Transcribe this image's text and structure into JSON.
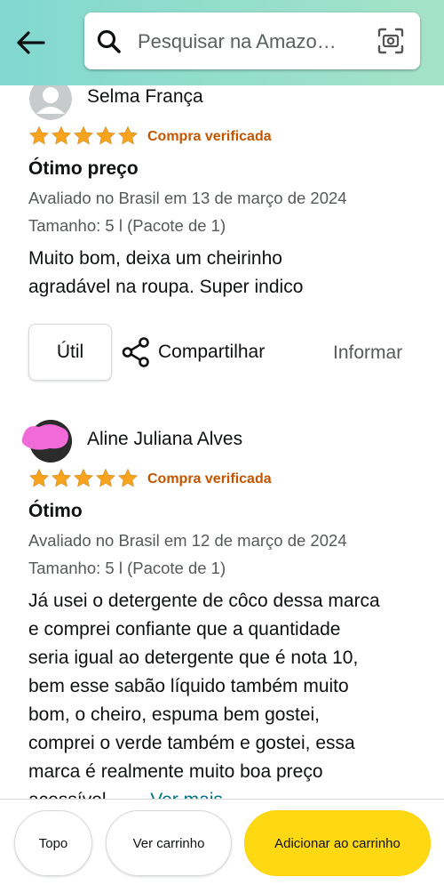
{
  "header": {
    "search_placeholder": "Pesquisar na Amazo…"
  },
  "reviews": [
    {
      "reviewer": "Selma França",
      "rating": 5,
      "verified_label": "Compra verificada",
      "title": "Ótimo preço",
      "date": "Avaliado no Brasil em 13 de março de 2024",
      "variant": "Tamanho: 5 l (Pacote de 1)",
      "body_lines": [
        "Muito bom, deixa um cheirinho",
        "agradável na roupa. Super indico"
      ],
      "helpful_label": "Útil",
      "share_label": "Compartilhar",
      "report_label": "Informar"
    },
    {
      "reviewer": "Aline Juliana Alves",
      "rating": 5,
      "verified_label": "Compra verificada",
      "title": "Ótimo",
      "date": "Avaliado no Brasil em 12 de março de 2024",
      "variant": "Tamanho: 5 l (Pacote de 1)",
      "body_lines": [
        "Já usei o detergente de côco dessa marca",
        "e comprei confiante que a quantidade",
        "seria igual ao detergente que é nota 10,",
        "bem esse sabão líquido também muito",
        "bom, o cheiro, espuma bem gostei,",
        "comprei o verde também e gostei, essa",
        "marca é realmente muito boa preço",
        "acessível"
      ],
      "more_label": "Ver mais"
    }
  ],
  "bottom_bar": {
    "top_label": "Topo",
    "cart_label": "Ver carrinho",
    "add_label": "Adicionar ao carrinho"
  },
  "colors": {
    "header_gradient_start": "#81d8d0",
    "header_gradient_end": "#a5e3c8",
    "star": "#f8a31e",
    "verified": "#c45500",
    "link": "#007185",
    "add_to_cart": "#ffd814"
  }
}
